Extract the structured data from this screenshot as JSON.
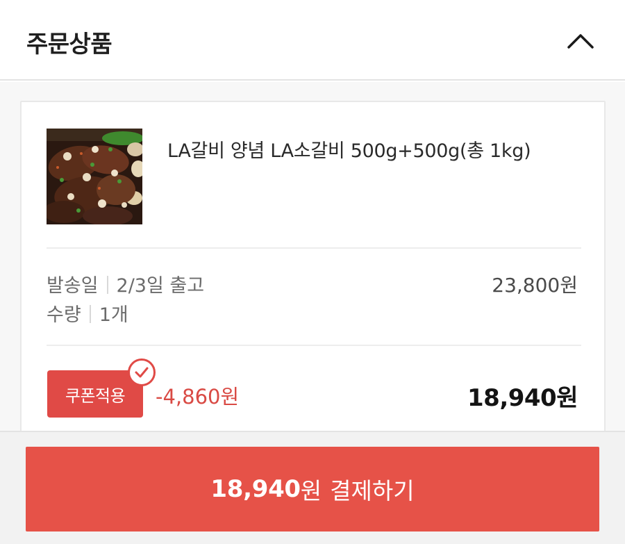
{
  "header": {
    "title": "주문상품",
    "toggle_icon": "chevron-up-icon"
  },
  "product": {
    "name": "LA갈비 양념 LA소갈비 500g+500g(총 1kg)",
    "image_icon": "grilled-galbi-photo",
    "ship_label": "발송일",
    "ship_value": "2/3일 출고",
    "qty_label": "수량",
    "qty_value": "1개",
    "original_price": "23,800원",
    "coupon_label": "쿠폰적용",
    "coupon_icon": "check-circle-icon",
    "discount": "-4,860원",
    "final_price": "18,940원"
  },
  "footer": {
    "pay_amount": "18,940",
    "pay_unit": "원",
    "pay_label": "결제하기"
  },
  "colors": {
    "accent": "#e65248",
    "coupon": "#e04a46",
    "discount_text": "#d94a44"
  }
}
